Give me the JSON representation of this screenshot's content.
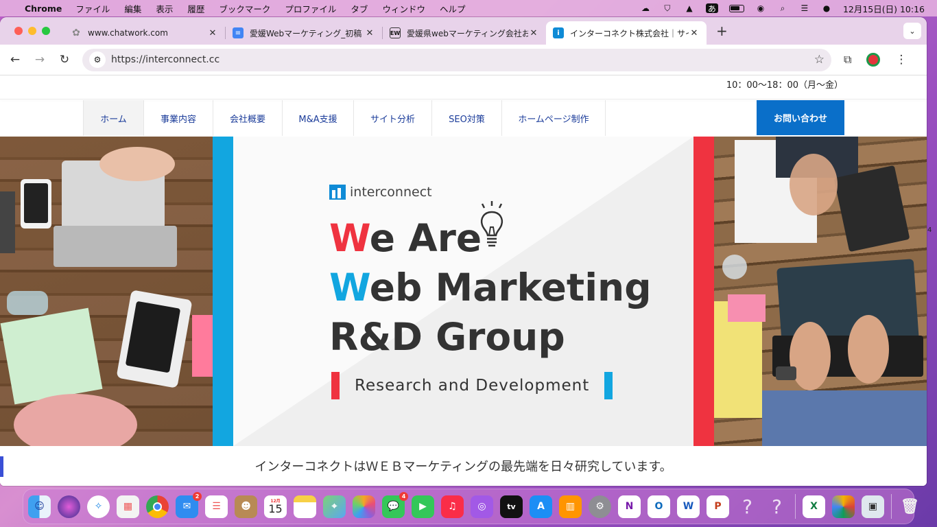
{
  "menubar": {
    "app_name": "Chrome",
    "items": [
      "ファイル",
      "編集",
      "表示",
      "履歴",
      "ブックマーク",
      "プロファイル",
      "タブ",
      "ウィンドウ",
      "ヘルプ"
    ],
    "ime": "あ",
    "clock": "12月15日(日)  10:16"
  },
  "tabs": [
    {
      "title": "www.chatwork.com",
      "icon": "chatwork-icon"
    },
    {
      "title": "愛媛Webマーケティング_初稿 の",
      "icon": "google-docs-icon"
    },
    {
      "title": "愛媛県webマーケティング会社お",
      "icon": "ew-icon"
    },
    {
      "title": "インターコネクト株式会社｜サイ",
      "icon": "interconnect-icon",
      "active": true
    }
  ],
  "toolbar": {
    "url": "https://interconnect.cc"
  },
  "page": {
    "hours": "10：00〜18：00（月〜金）",
    "nav": [
      "ホーム",
      "事業内容",
      "会社概要",
      "M&A支援",
      "サイト分析",
      "SEO対策",
      "ホームページ制作"
    ],
    "contact": "お問い合わせ",
    "hero": {
      "logo_text": "interconnect",
      "line1_accent": "W",
      "line1_rest": "e Are",
      "line2_accent": "W",
      "line2_rest": "eb Marketing",
      "line3": "R&D Group",
      "tagline": "Research and Development"
    },
    "subline": "インターコネクトはＷＥＢマーケティングの最先端を日々研究しています。"
  },
  "colors": {
    "accent_blue": "#12a6e0",
    "accent_red": "#ef3340",
    "contact_bg": "#0a6fc9",
    "nav_text": "#1b3c9a"
  },
  "dock": {
    "calendar_month": "12月",
    "calendar_day": "15",
    "mail_badge": "2",
    "messages_badge": "4",
    "apps": [
      "finder",
      "siri",
      "safari",
      "launchpad",
      "chrome",
      "mail",
      "reminders",
      "contacts",
      "calendar",
      "notes",
      "maps",
      "photos",
      "messages",
      "facetime",
      "music",
      "podcasts",
      "tv",
      "app-store",
      "books",
      "system-settings",
      "onenote",
      "outlook",
      "word",
      "powerpoint",
      "unknown-app",
      "unknown-app",
      "excel",
      "photo-app",
      "preview",
      "trash"
    ]
  }
}
